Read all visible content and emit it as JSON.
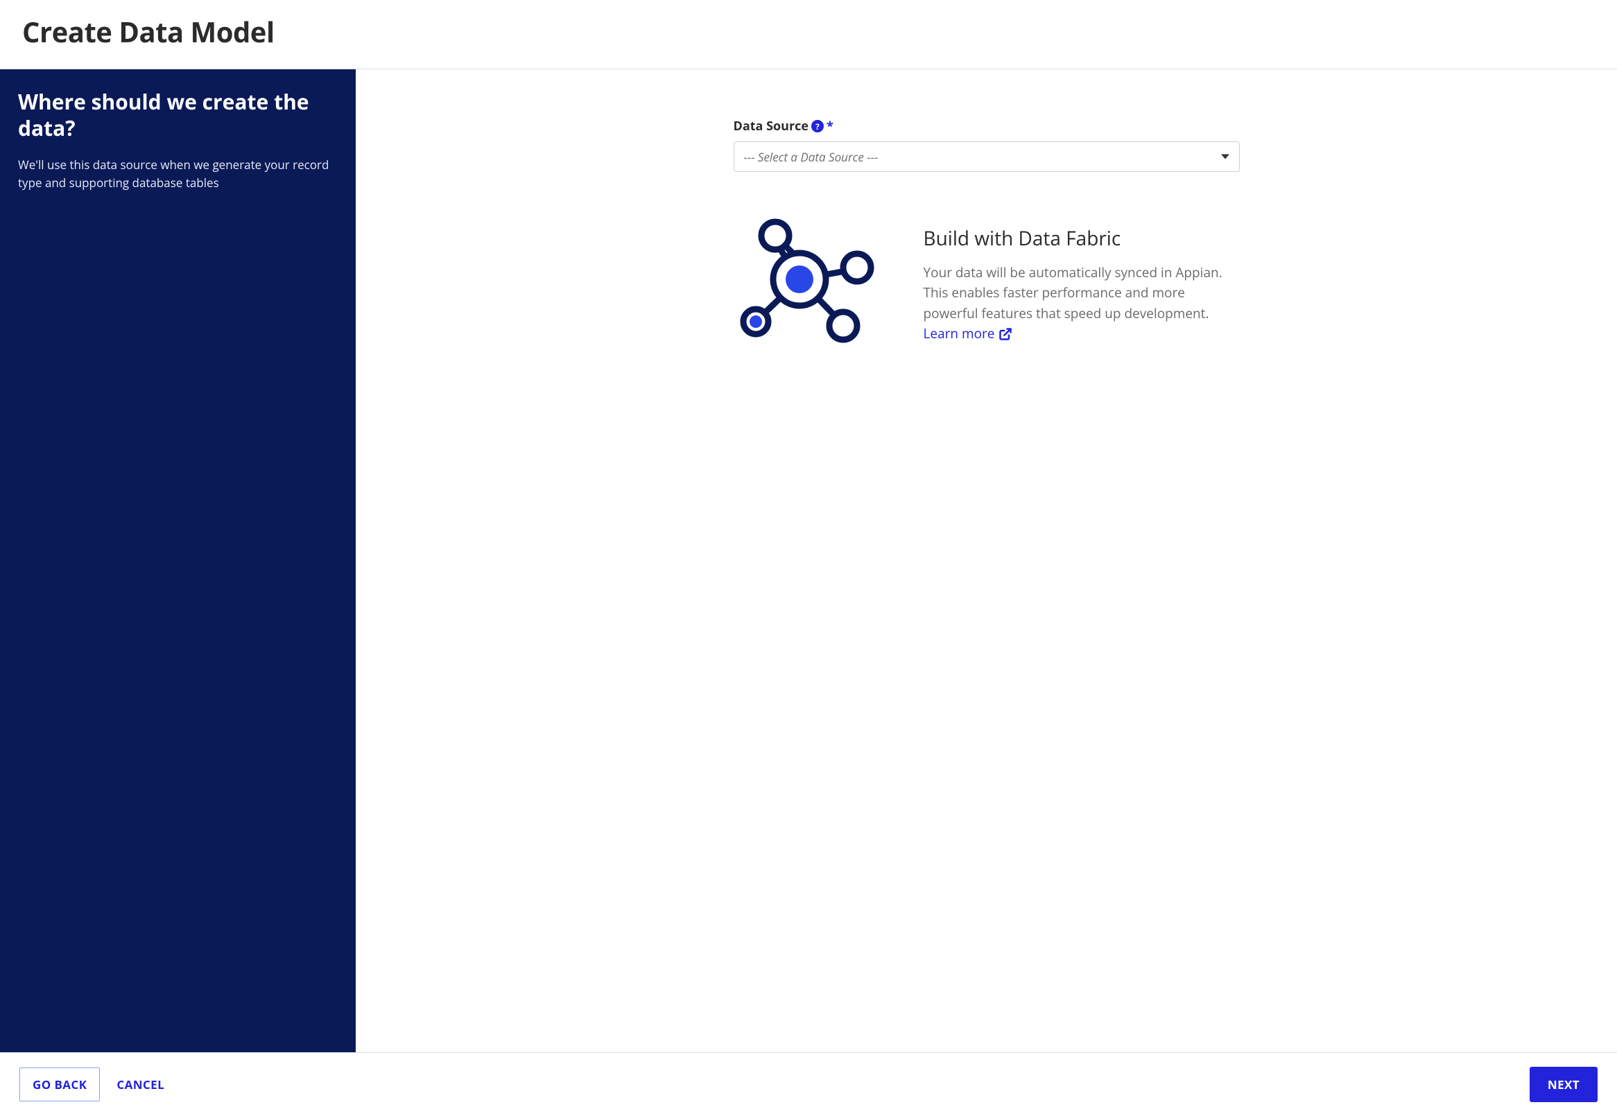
{
  "header": {
    "title": "Create Data Model"
  },
  "sidebar": {
    "heading": "Where should we create the data?",
    "body": "We'll use this data source when we generate your record type and supporting database tables"
  },
  "main": {
    "data_source": {
      "label": "Data Source",
      "required_marker": "*",
      "placeholder": "--- Select a Data Source ---"
    },
    "info": {
      "title": "Build with Data Fabric",
      "body": "Your data will be automatically synced in Appian. This enables faster performance and more powerful features that speed up development.",
      "learn_more": "Learn more"
    }
  },
  "footer": {
    "go_back": "GO BACK",
    "cancel": "CANCEL",
    "next": "NEXT"
  },
  "icons": {
    "help": "help-icon",
    "caret": "chevron-down-icon",
    "external": "external-link-icon",
    "fabric": "data-fabric-icon"
  },
  "colors": {
    "sidebar_bg": "#0a1a57",
    "primary": "#2323dc",
    "stroke_dark": "#0a1a57"
  }
}
